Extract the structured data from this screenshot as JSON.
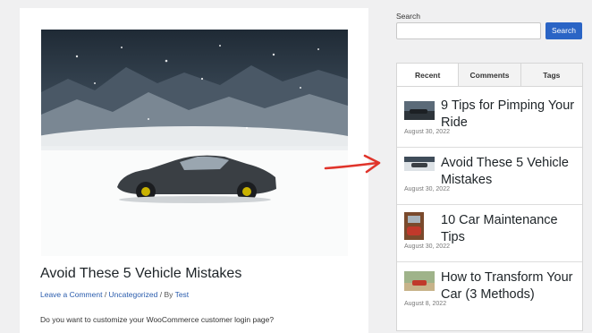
{
  "article": {
    "title": "Avoid These 5 Vehicle Mistakes",
    "meta_comment": "Leave a Comment",
    "meta_sep1": " / ",
    "meta_category": "Uncategorized",
    "meta_sep2": " / By ",
    "meta_author": "Test",
    "excerpt": "Do you want to customize your WooCommerce customer login page?"
  },
  "sidebar": {
    "search_label": "Search",
    "search_placeholder": "",
    "search_button": "Search",
    "tabs": [
      {
        "label": "Recent"
      },
      {
        "label": "Comments"
      },
      {
        "label": "Tags"
      }
    ],
    "posts": [
      {
        "title": "9 Tips for Pimping Your Ride",
        "date": "August 30, 2022"
      },
      {
        "title": "Avoid These 5 Vehicle Mistakes",
        "date": "August 30, 2022"
      },
      {
        "title": "10 Car Maintenance Tips",
        "date": "August 30, 2022"
      },
      {
        "title": "How to Transform Your Car (3 Methods)",
        "date": "August 8, 2022"
      }
    ]
  },
  "colors": {
    "accent": "#2a64c5",
    "link": "#2a5cad",
    "arrow": "#e0342b"
  }
}
